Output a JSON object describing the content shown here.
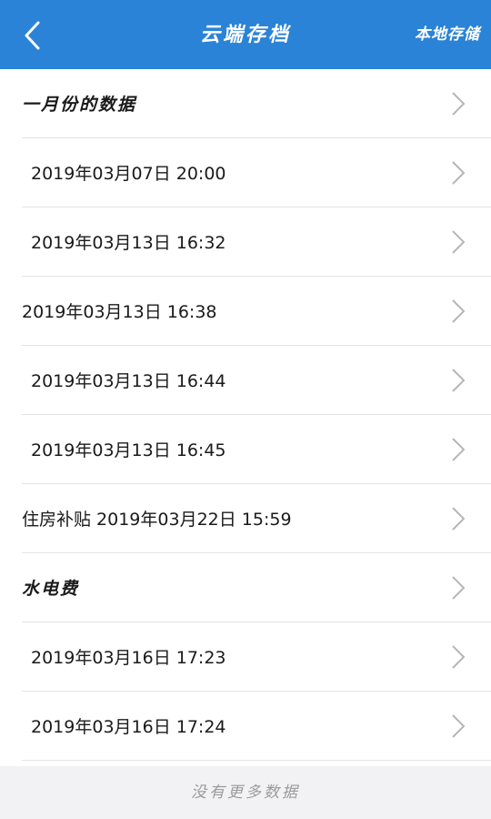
{
  "header": {
    "title": "云端存档",
    "right_button": "本地存储",
    "background_color": "#2a83d6",
    "back_icon": "chevron-left-icon"
  },
  "list": {
    "items": [
      {
        "label": "一月份的数据"
      },
      {
        "label": "2019年03月07日  20:00"
      },
      {
        "label": "2019年03月13日  16:32"
      },
      {
        "label": "2019年03月13日  16:38"
      },
      {
        "label": "2019年03月13日  16:44"
      },
      {
        "label": "2019年03月13日  16:45"
      },
      {
        "label": "住房补贴  2019年03月22日  15:59"
      },
      {
        "label": "水电费"
      },
      {
        "label": "2019年03月16日  17:23"
      },
      {
        "label": "2019年03月16日  17:24"
      }
    ],
    "row_icon": "chevron-right-icon"
  },
  "footer": {
    "text": "没有更多数据"
  }
}
